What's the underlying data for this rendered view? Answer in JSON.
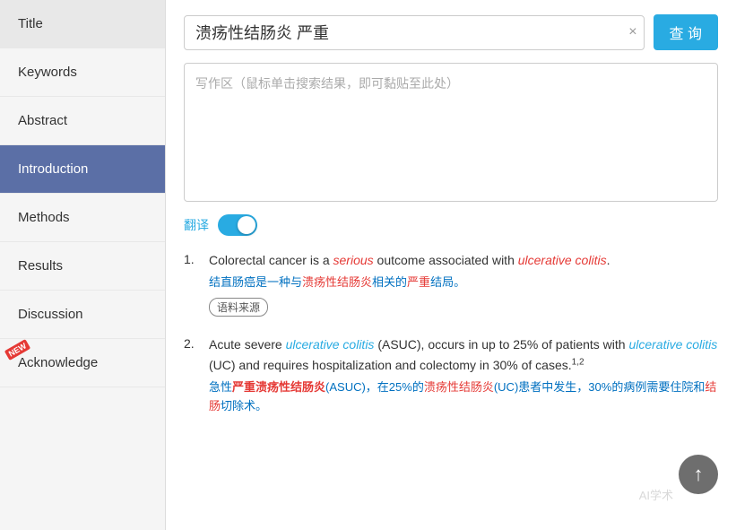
{
  "sidebar": {
    "items": [
      {
        "id": "title",
        "label": "Title",
        "active": false,
        "new": false
      },
      {
        "id": "keywords",
        "label": "Keywords",
        "active": false,
        "new": false
      },
      {
        "id": "abstract",
        "label": "Abstract",
        "active": false,
        "new": false
      },
      {
        "id": "introduction",
        "label": "Introduction",
        "active": true,
        "new": false
      },
      {
        "id": "methods",
        "label": "Methods",
        "active": false,
        "new": false
      },
      {
        "id": "results",
        "label": "Results",
        "active": false,
        "new": false
      },
      {
        "id": "discussion",
        "label": "Discussion",
        "active": false,
        "new": false
      },
      {
        "id": "acknowledge",
        "label": "Acknowledge",
        "active": false,
        "new": true
      }
    ]
  },
  "header": {
    "search_value": "溃疡性结肠炎 严重",
    "clear_label": "×",
    "query_label": "查 询"
  },
  "writing_area": {
    "placeholder": "写作区（鼠标单击搜索结果，即可黏贴至此处）"
  },
  "translate": {
    "label": "翻译"
  },
  "results": [
    {
      "num": "1.",
      "en_parts": [
        {
          "text": "Colorectal cancer is a ",
          "style": "normal"
        },
        {
          "text": "serious",
          "style": "italic-red"
        },
        {
          "text": " outcome associated with ",
          "style": "normal"
        },
        {
          "text": "ulcerative colitis",
          "style": "italic-red"
        },
        {
          "text": ".",
          "style": "normal"
        }
      ],
      "cn_parts": [
        {
          "text": "结直肠癌是一种与",
          "style": "normal"
        },
        {
          "text": "溃疡性结肠炎",
          "style": "cn-red"
        },
        {
          "text": "相关的",
          "style": "normal"
        },
        {
          "text": "严重",
          "style": "cn-red"
        },
        {
          "text": "结局。",
          "style": "normal"
        }
      ],
      "source_label": "语料来源"
    },
    {
      "num": "2.",
      "en_parts": [
        {
          "text": "Acute severe ",
          "style": "normal"
        },
        {
          "text": "ulcerative colitis",
          "style": "italic-blue"
        },
        {
          "text": " (ASUC), occurs in up to 25% of patients with ",
          "style": "normal"
        },
        {
          "text": "ulcerative colitis",
          "style": "italic-blue"
        },
        {
          "text": " (UC) and requires hospitalization and colectomy in 30% of cases.1,2",
          "style": "normal"
        }
      ],
      "cn_parts": [
        {
          "text": "急性",
          "style": "normal"
        },
        {
          "text": "严重溃疡性结肠炎",
          "style": "cn-em"
        },
        {
          "text": "(ASUC)，在25%的",
          "style": "normal"
        },
        {
          "text": "溃疡性结肠炎",
          "style": "cn-red"
        },
        {
          "text": "(UC)患者中发生，",
          "style": "normal"
        },
        {
          "text": "30%",
          "style": "normal"
        },
        {
          "text": "的病例需要住院和",
          "style": "normal"
        },
        {
          "text": "结肠",
          "style": "cn-red"
        },
        {
          "text": "切除术。",
          "style": "normal"
        }
      ],
      "source_label": null
    }
  ],
  "scroll_up": "↑",
  "watermark": "AI学术"
}
